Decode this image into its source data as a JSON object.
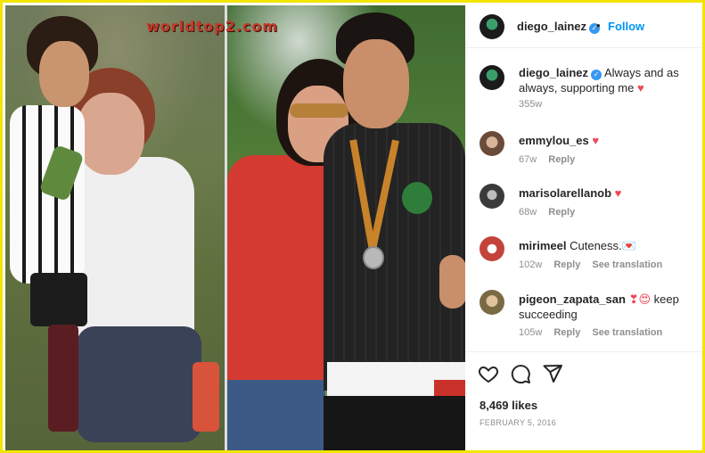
{
  "watermark": "worldtop2.com",
  "post": {
    "username": "diego_lainez",
    "verified": true,
    "follow_label": "Follow",
    "separator": "•",
    "caption": {
      "username": "diego_lainez",
      "text": "Always and as always, supporting me",
      "emoji": "♥",
      "time": "355w"
    },
    "likes": "8,469 likes",
    "date": "FEBRUARY 5, 2016"
  },
  "comments": [
    {
      "username": "emmylou_es",
      "text": "",
      "emoji": "♥",
      "time": "67w",
      "reply": "Reply",
      "translate": ""
    },
    {
      "username": "marisolarellanob",
      "text": "",
      "emoji": "♥",
      "time": "68w",
      "reply": "Reply",
      "translate": ""
    },
    {
      "username": "mirimeel",
      "text": "Cuteness.",
      "emoji": "💌",
      "time": "102w",
      "reply": "Reply",
      "translate": "See translation"
    },
    {
      "username": "pigeon_zapata_san",
      "text": "keep succeeding",
      "emoji": "❣😍",
      "time": "105w",
      "reply": "Reply",
      "translate": "See translation"
    }
  ],
  "icons": [
    "heart-icon",
    "comment-icon",
    "share-icon",
    "verified-icon"
  ],
  "colors": {
    "frame": "#f2e600",
    "follow": "#0095f6",
    "heart": "#ed4956",
    "verified": "#3897f0"
  }
}
